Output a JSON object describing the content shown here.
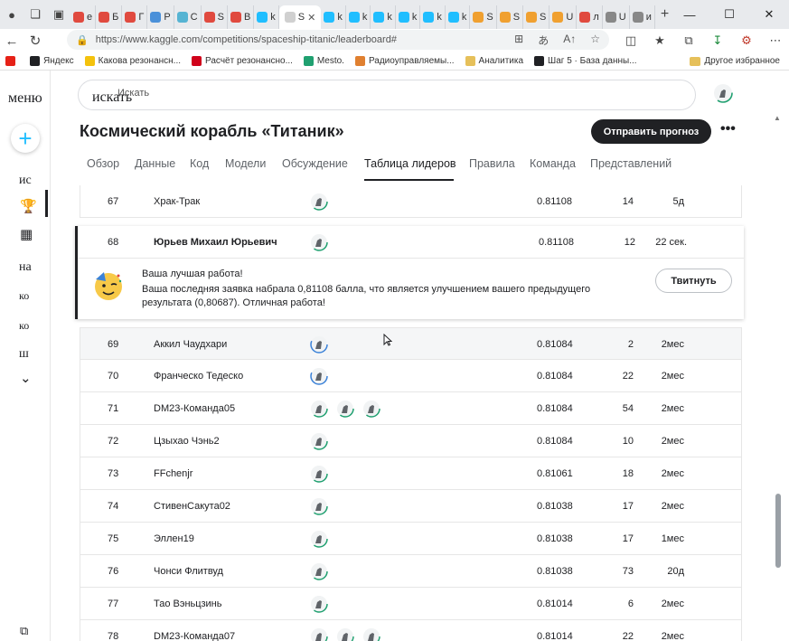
{
  "browser": {
    "tabs": [
      {
        "label": "е",
        "color": "#e04a3f"
      },
      {
        "label": "Б",
        "color": "#e04a3f"
      },
      {
        "label": "Г",
        "color": "#e04a3f"
      },
      {
        "label": "Р",
        "color": "#4a90d9"
      },
      {
        "label": "С",
        "color": "#56b4d3"
      },
      {
        "label": "S",
        "color": "#e04a3f"
      },
      {
        "label": "В",
        "color": "#e04a3f"
      },
      {
        "label": "k",
        "color": "#20beff"
      },
      {
        "label": "S",
        "color": "#d0d0d0",
        "active": true
      },
      {
        "label": "k",
        "color": "#20beff"
      },
      {
        "label": "k",
        "color": "#20beff"
      },
      {
        "label": "k",
        "color": "#20beff"
      },
      {
        "label": "k",
        "color": "#20beff"
      },
      {
        "label": "k",
        "color": "#20beff"
      },
      {
        "label": "k",
        "color": "#20beff"
      },
      {
        "label": "S",
        "color": "#f0a030"
      },
      {
        "label": "S",
        "color": "#f0a030"
      },
      {
        "label": "S",
        "color": "#f0a030"
      },
      {
        "label": "U",
        "color": "#f0a030"
      },
      {
        "label": "л",
        "color": "#e04a3f"
      },
      {
        "label": "U",
        "color": "#888888"
      },
      {
        "label": "и",
        "color": "#888888"
      }
    ],
    "active_tab_close": "✕",
    "new_tab": "+",
    "window_controls": {
      "minimize": "—",
      "maximize": "☐",
      "close": "✕"
    },
    "url": "https://www.kaggle.com/competitions/spaceship-titanic/leaderboard#",
    "bookmarks": [
      {
        "label": "",
        "color": "#e62117"
      },
      {
        "label": "Яндекс",
        "color": "#202124"
      },
      {
        "label": "Какова резонансн...",
        "color": "#f4c20d"
      },
      {
        "label": "Расчёт резонансно...",
        "color": "#d0021b"
      },
      {
        "label": "Mesto.",
        "color": "#20a070"
      },
      {
        "label": "Радиоуправляемы...",
        "color": "#e08030"
      },
      {
        "label": "Аналитика",
        "color": "#e6c05a"
      },
      {
        "label": "Шаг 5 · База данны...",
        "color": "#202124"
      }
    ],
    "other_bookmarks": "Другое избранное"
  },
  "sidebar": {
    "menu_label": "меню",
    "create_icon": "+",
    "items": [
      {
        "label": "ис"
      },
      {
        "label": "на"
      },
      {
        "label": "ко"
      },
      {
        "label": "ко"
      },
      {
        "label": "ш"
      }
    ],
    "more_icon": "⌄"
  },
  "search": {
    "label_serif": "искать",
    "label_small": "Искать"
  },
  "competition": {
    "title": "Космический корабль «Титаник»",
    "submit_label": "Отправить прогноз",
    "more_label": "•••"
  },
  "tabs": [
    {
      "label": "Обзор"
    },
    {
      "label": "Данные"
    },
    {
      "label": "Код"
    },
    {
      "label": "Модели"
    },
    {
      "label": "Обсуждение"
    },
    {
      "label": "Таблица лидеров",
      "selected": true
    },
    {
      "label": "Правила"
    },
    {
      "label": "Команда"
    },
    {
      "label": "Представлений"
    }
  ],
  "leaderboard": {
    "row_67": {
      "rank": "67",
      "team": "Храк-Трак",
      "score": "0.81108",
      "entries": "14",
      "last": "5д"
    },
    "my_entry": {
      "rank": "68",
      "team": "Юрьев Михаил Юрьевич",
      "score": "0.81108",
      "entries": "12",
      "last": "22 сек.",
      "message_title": "Ваша лучшая работа!",
      "message_body": "Ваша последняя заявка набрала 0,81108 балла, что является улучшением вашего предыдущего результата (0,80687). Отличная работа!",
      "tweet_label": "Твитнуть"
    },
    "rows": [
      {
        "rank": "69",
        "team": "Аккил Чаудхари",
        "members": 1,
        "score": "0.81084",
        "entries": "2",
        "last": "2мес",
        "ring": "blue"
      },
      {
        "rank": "70",
        "team": "Франческо Тедеско",
        "members": 1,
        "score": "0.81084",
        "entries": "22",
        "last": "2мес",
        "ring": "blue"
      },
      {
        "rank": "71",
        "team": "DM23-Команда05",
        "members": 3,
        "score": "0.81084",
        "entries": "54",
        "last": "2мес",
        "ring": "green"
      },
      {
        "rank": "72",
        "team": "Цзыхао Чэнь2",
        "members": 1,
        "score": "0.81084",
        "entries": "10",
        "last": "2мес",
        "ring": "green"
      },
      {
        "rank": "73",
        "team": "FFchenjr",
        "members": 1,
        "score": "0.81061",
        "entries": "18",
        "last": "2мес",
        "ring": "green"
      },
      {
        "rank": "74",
        "team": "СтивенСакута02",
        "members": 1,
        "score": "0.81038",
        "entries": "17",
        "last": "2мес",
        "ring": "green"
      },
      {
        "rank": "75",
        "team": "Эллен19",
        "members": 1,
        "score": "0.81038",
        "entries": "17",
        "last": "1мес",
        "ring": "green"
      },
      {
        "rank": "76",
        "team": "Чонси Флитвуд",
        "members": 1,
        "score": "0.81038",
        "entries": "73",
        "last": "20д",
        "ring": "green"
      },
      {
        "rank": "77",
        "team": "Тао Вэньцзинь",
        "members": 1,
        "score": "0.81014",
        "entries": "6",
        "last": "2мес",
        "ring": "green"
      },
      {
        "rank": "78",
        "team": "DM23-Команда07",
        "members": 3,
        "score": "0.81014",
        "entries": "22",
        "last": "2мес",
        "ring": "green"
      }
    ]
  },
  "colors": {
    "kaggle_blue": "#20beff",
    "ring_green": "#20a070",
    "ring_blue": "#3b82d8",
    "dark": "#202124"
  }
}
